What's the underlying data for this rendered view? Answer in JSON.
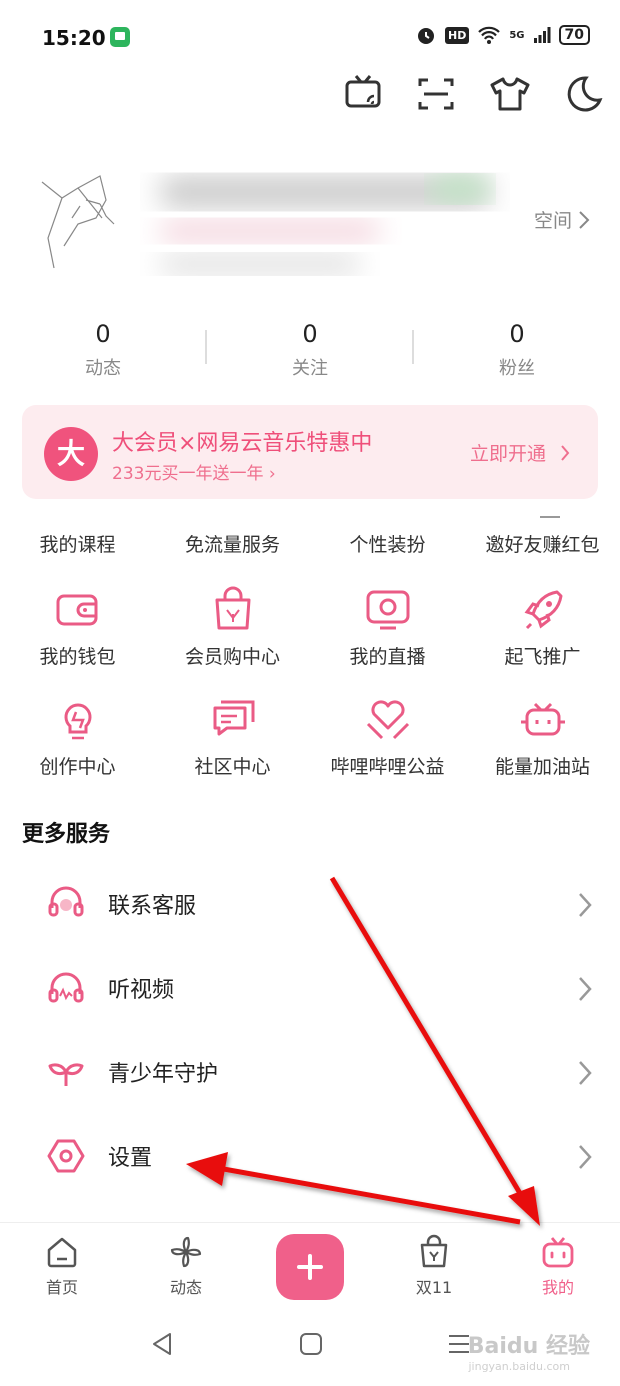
{
  "status": {
    "time": "15:20",
    "hd": "HD",
    "signal": "5G",
    "battery": "70"
  },
  "profile": {
    "space_label": "空间"
  },
  "stats": [
    {
      "value": "0",
      "label": "动态"
    },
    {
      "value": "0",
      "label": "关注"
    },
    {
      "value": "0",
      "label": "粉丝"
    }
  ],
  "vip": {
    "badge": "大",
    "title": "大会员×网易云音乐特惠中",
    "subtitle": "233元买一年送一年 ›",
    "action": "立即开通"
  },
  "top_row": [
    "我的课程",
    "免流量服务",
    "个性装扮",
    "邀好友赚红包"
  ],
  "grid": [
    {
      "label": "我的钱包",
      "icon": "wallet-icon"
    },
    {
      "label": "会员购中心",
      "icon": "shopping-bag-icon"
    },
    {
      "label": "我的直播",
      "icon": "live-tv-icon"
    },
    {
      "label": "起飞推广",
      "icon": "rocket-icon"
    },
    {
      "label": "创作中心",
      "icon": "lightbulb-icon"
    },
    {
      "label": "社区中心",
      "icon": "chat-icon"
    },
    {
      "label": "哔哩哔哩公益",
      "icon": "heart-hands-icon"
    },
    {
      "label": "能量加油站",
      "icon": "energy-tv-icon"
    }
  ],
  "more": {
    "title": "更多服务",
    "items": [
      {
        "label": "联系客服",
        "icon": "headset-icon"
      },
      {
        "label": "听视频",
        "icon": "headphones-icon"
      },
      {
        "label": "青少年守护",
        "icon": "sprout-icon"
      },
      {
        "label": "设置",
        "icon": "hexagon-settings-icon"
      }
    ]
  },
  "nav": [
    {
      "label": "首页",
      "icon": "home-icon"
    },
    {
      "label": "动态",
      "icon": "pinwheel-icon"
    },
    {
      "label": "",
      "icon": "plus-icon"
    },
    {
      "label": "双11",
      "icon": "shopping-bag-icon"
    },
    {
      "label": "我的",
      "icon": "bilibili-tv-icon"
    }
  ],
  "watermark": {
    "text": "Baidu 经验",
    "sub": "jingyan.baidu.com"
  },
  "colors": {
    "accent": "#f0608a",
    "vip_bg": "#fdecef",
    "text_gray": "#888888",
    "annotation_red": "#e81010"
  }
}
